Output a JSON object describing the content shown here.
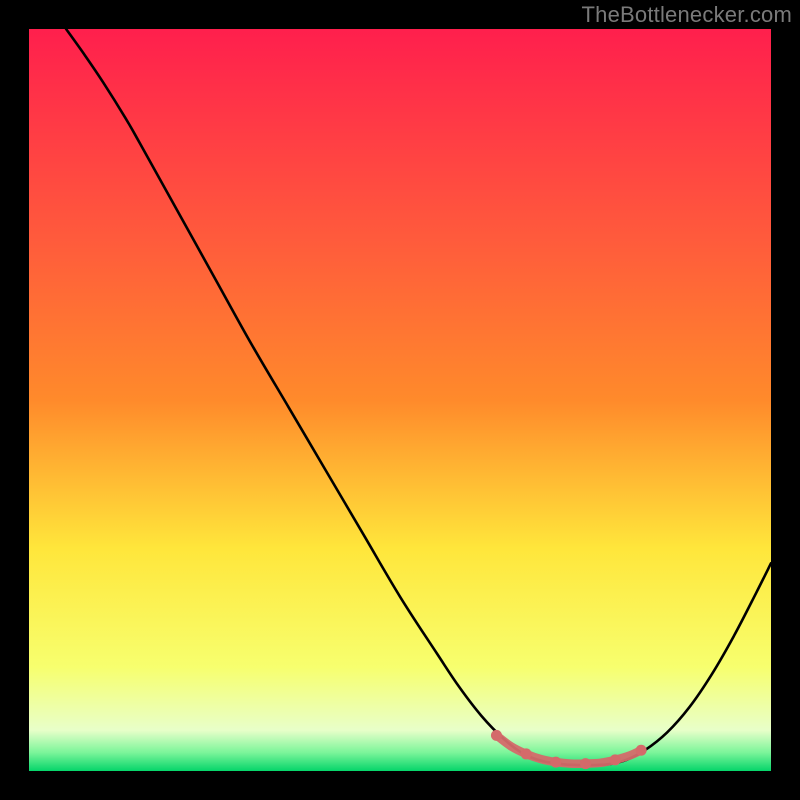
{
  "watermark": "TheBottlenecker.com",
  "chart_data": {
    "type": "line",
    "title": "",
    "xlabel": "",
    "ylabel": "",
    "xlim": [
      0,
      100
    ],
    "ylim": [
      0,
      100
    ],
    "grid": false,
    "legend": false,
    "gradient": {
      "top": "#ff1f4d",
      "mid1": "#ff8a2b",
      "mid2": "#ffe63b",
      "mid3": "#f7ff6e",
      "low": "#e8ffc9",
      "bottom": "#05d56a"
    },
    "series": [
      {
        "name": "curve",
        "color": "#000000",
        "width": 2.6,
        "points": [
          {
            "x": 5.0,
            "y": 100.0
          },
          {
            "x": 7.5,
            "y": 96.5
          },
          {
            "x": 10.0,
            "y": 92.8
          },
          {
            "x": 13.0,
            "y": 88.0
          },
          {
            "x": 15.0,
            "y": 84.5
          },
          {
            "x": 20.0,
            "y": 75.5
          },
          {
            "x": 25.0,
            "y": 66.5
          },
          {
            "x": 30.0,
            "y": 57.5
          },
          {
            "x": 35.0,
            "y": 49.0
          },
          {
            "x": 40.0,
            "y": 40.5
          },
          {
            "x": 45.0,
            "y": 32.0
          },
          {
            "x": 50.0,
            "y": 23.5
          },
          {
            "x": 55.0,
            "y": 15.8
          },
          {
            "x": 58.0,
            "y": 11.3
          },
          {
            "x": 61.0,
            "y": 7.4
          },
          {
            "x": 64.0,
            "y": 4.3
          },
          {
            "x": 66.5,
            "y": 2.4
          },
          {
            "x": 69.0,
            "y": 1.4
          },
          {
            "x": 72.0,
            "y": 0.9
          },
          {
            "x": 75.0,
            "y": 0.8
          },
          {
            "x": 78.0,
            "y": 0.9
          },
          {
            "x": 80.5,
            "y": 1.5
          },
          {
            "x": 83.0,
            "y": 2.8
          },
          {
            "x": 86.0,
            "y": 5.2
          },
          {
            "x": 89.0,
            "y": 8.6
          },
          {
            "x": 92.0,
            "y": 13.0
          },
          {
            "x": 95.0,
            "y": 18.2
          },
          {
            "x": 98.0,
            "y": 24.0
          },
          {
            "x": 100.0,
            "y": 28.0
          }
        ]
      },
      {
        "name": "highlight",
        "color": "#d46a6a",
        "width": 8.5,
        "points": [
          {
            "x": 63.0,
            "y": 4.8
          },
          {
            "x": 65.0,
            "y": 3.3
          },
          {
            "x": 67.0,
            "y": 2.3
          },
          {
            "x": 69.0,
            "y": 1.6
          },
          {
            "x": 71.0,
            "y": 1.2
          },
          {
            "x": 73.0,
            "y": 1.0
          },
          {
            "x": 75.0,
            "y": 1.0
          },
          {
            "x": 77.0,
            "y": 1.1
          },
          {
            "x": 79.0,
            "y": 1.5
          },
          {
            "x": 81.0,
            "y": 2.1
          },
          {
            "x": 82.5,
            "y": 2.8
          }
        ],
        "dot_radius": 5.5
      }
    ]
  }
}
